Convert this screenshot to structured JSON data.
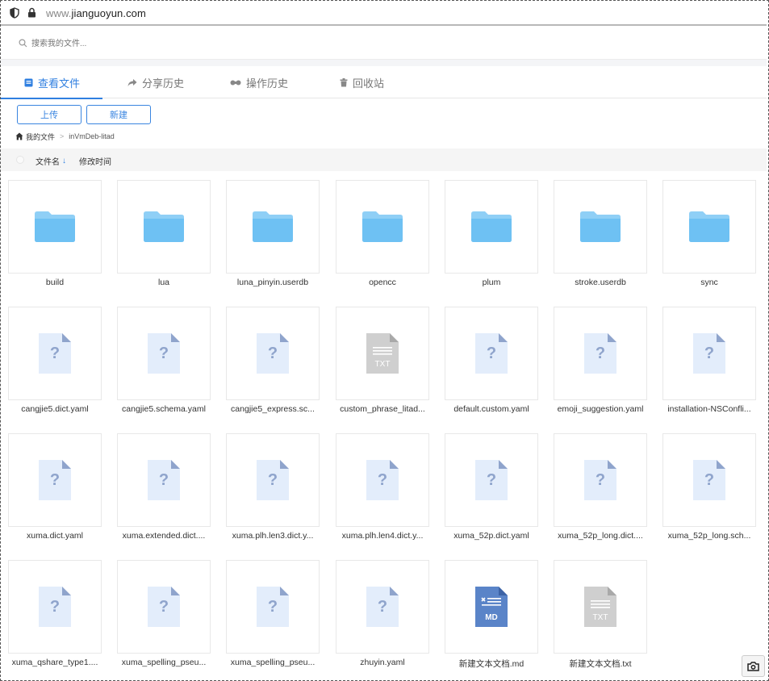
{
  "browser": {
    "url_prefix": "www.",
    "url_domain": "jianguoyun.com"
  },
  "search": {
    "placeholder": "搜索我的文件..."
  },
  "tabs": [
    {
      "label": "查看文件",
      "icon": "file-view-icon",
      "active": true
    },
    {
      "label": "分享历史",
      "icon": "share-icon",
      "active": false
    },
    {
      "label": "操作历史",
      "icon": "history-icon",
      "active": false
    },
    {
      "label": "回收站",
      "icon": "trash-icon",
      "active": false
    }
  ],
  "toolbar": {
    "upload_label": "上传",
    "new_label": "新建"
  },
  "breadcrumb": {
    "root": "我的文件",
    "separator": ">",
    "current": "inVmDeb-litad"
  },
  "list_header": {
    "name_col": "文件名",
    "sort_arrow": "↓",
    "modified_col": "修改时间"
  },
  "files": [
    {
      "name": "build",
      "type": "folder"
    },
    {
      "name": "lua",
      "type": "folder"
    },
    {
      "name": "luna_pinyin.userdb",
      "type": "folder"
    },
    {
      "name": "opencc",
      "type": "folder"
    },
    {
      "name": "plum",
      "type": "folder"
    },
    {
      "name": "stroke.userdb",
      "type": "folder"
    },
    {
      "name": "sync",
      "type": "folder"
    },
    {
      "name": "cangjie5.dict.yaml",
      "type": "unknown"
    },
    {
      "name": "cangjie5.schema.yaml",
      "type": "unknown"
    },
    {
      "name": "cangjie5_express.sc...",
      "type": "unknown"
    },
    {
      "name": "custom_phrase_litad...",
      "type": "txt"
    },
    {
      "name": "default.custom.yaml",
      "type": "unknown"
    },
    {
      "name": "emoji_suggestion.yaml",
      "type": "unknown"
    },
    {
      "name": "installation-NSConfli...",
      "type": "unknown"
    },
    {
      "name": "xuma.dict.yaml",
      "type": "unknown"
    },
    {
      "name": "xuma.extended.dict....",
      "type": "unknown"
    },
    {
      "name": "xuma.plh.len3.dict.y...",
      "type": "unknown"
    },
    {
      "name": "xuma.plh.len4.dict.y...",
      "type": "unknown"
    },
    {
      "name": "xuma_52p.dict.yaml",
      "type": "unknown"
    },
    {
      "name": "xuma_52p_long.dict....",
      "type": "unknown"
    },
    {
      "name": "xuma_52p_long.sch...",
      "type": "unknown"
    },
    {
      "name": "xuma_qshare_type1....",
      "type": "unknown"
    },
    {
      "name": "xuma_spelling_pseu...",
      "type": "unknown"
    },
    {
      "name": "xuma_spelling_pseu...",
      "type": "unknown"
    },
    {
      "name": "zhuyin.yaml",
      "type": "unknown"
    },
    {
      "name": "新建文本文档.md",
      "type": "md"
    },
    {
      "name": "新建文本文档.txt",
      "type": "txt"
    }
  ],
  "icon_text": {
    "unknown": "?",
    "txt": "TXT",
    "md": "MD"
  },
  "colors": {
    "accent": "#2f7fe0",
    "folder_back": "#8fcff6",
    "folder_front": "#6ec1f3",
    "unknown_fill": "#e3edfb",
    "unknown_corner": "#8fa4cc",
    "txt_fill": "#cfcfcf",
    "md_fill": "#5a84c8"
  }
}
